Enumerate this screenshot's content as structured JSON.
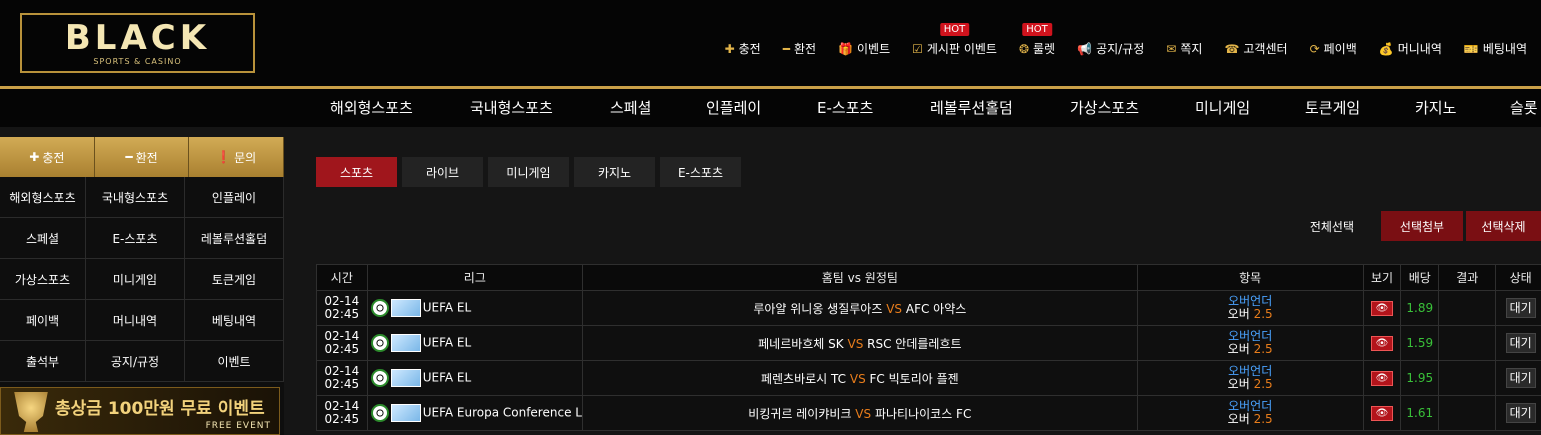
{
  "brand": {
    "logo_main": "BLACK",
    "logo_sub": "SPORTS & CASINO",
    "accent": "#caa048"
  },
  "top_menu": [
    {
      "icon": "plus-icon",
      "glyph": "✚",
      "label": "충전",
      "hot": ""
    },
    {
      "icon": "minus-icon",
      "glyph": "━",
      "label": "환전",
      "hot": ""
    },
    {
      "icon": "gift-icon",
      "glyph": "🎁",
      "label": "이벤트",
      "hot": ""
    },
    {
      "icon": "checkbox-icon",
      "glyph": "☑",
      "label": "게시판 이벤트",
      "hot": "HOT"
    },
    {
      "icon": "roulette-icon",
      "glyph": "❂",
      "label": "룰렛",
      "hot": "HOT"
    },
    {
      "icon": "megaphone-icon",
      "glyph": "📢",
      "label": "공지/규정",
      "hot": ""
    },
    {
      "icon": "envelope-icon",
      "glyph": "✉",
      "label": "쪽지",
      "hot": ""
    },
    {
      "icon": "support-icon",
      "glyph": "☎",
      "label": "고객센터",
      "hot": ""
    },
    {
      "icon": "refresh-icon",
      "glyph": "⟳",
      "label": "페이백",
      "hot": ""
    },
    {
      "icon": "moneybag-icon",
      "glyph": "💰",
      "label": "머니내역",
      "hot": ""
    },
    {
      "icon": "ticket-icon",
      "glyph": "🎫",
      "label": "베팅내역",
      "hot": ""
    }
  ],
  "main_nav": [
    "해외형스포츠",
    "국내형스포츠",
    "스페셜",
    "인플레이",
    "E-스포츠",
    "레볼루션홀덤",
    "가상스포츠",
    "미니게임",
    "토큰게임",
    "카지노",
    "슬롯"
  ],
  "sidebar": {
    "top": [
      {
        "icon": "plus-icon",
        "glyph": "✚",
        "label": "충전"
      },
      {
        "icon": "minus-icon",
        "glyph": "━",
        "label": "환전"
      },
      {
        "icon": "info-icon",
        "glyph": "❗",
        "label": "문의"
      }
    ],
    "grid": [
      "해외형스포츠",
      "국내형스포츠",
      "인플레이",
      "스페셜",
      "E-스포츠",
      "레볼루션홀덤",
      "가상스포츠",
      "미니게임",
      "토큰게임",
      "페이백",
      "머니내역",
      "베팅내역",
      "출석부",
      "공지/규정",
      "이벤트"
    ],
    "banner_title": "총상금 100만원 무료 이벤트",
    "banner_sub": "FREE EVENT"
  },
  "tabs": [
    "스포츠",
    "라이브",
    "미니게임",
    "카지노",
    "E-스포츠"
  ],
  "actions": {
    "select_all": "전체선택",
    "attach": "선택첨부",
    "delete": "선택삭제"
  },
  "table": {
    "headers": [
      "시간",
      "리그",
      "홈팀 vs 원정팀",
      "항목",
      "보기",
      "배당",
      "결과",
      "상태"
    ],
    "rows": [
      {
        "date": "02-14",
        "time": "02:45",
        "league": "UEFA EL",
        "home": "루아얄 위니옹 생질루아즈",
        "vs": "VS",
        "away": "AFC 아약스",
        "market": "오버언더",
        "pick": "오버",
        "line": "2.5",
        "odds": "1.89",
        "result": "",
        "status": "대기"
      },
      {
        "date": "02-14",
        "time": "02:45",
        "league": "UEFA EL",
        "home": "페네르바흐체 SK",
        "vs": "VS",
        "away": "RSC 안데를레흐트",
        "market": "오버언더",
        "pick": "오버",
        "line": "2.5",
        "odds": "1.59",
        "result": "",
        "status": "대기"
      },
      {
        "date": "02-14",
        "time": "02:45",
        "league": "UEFA EL",
        "home": "페렌츠바로시 TC",
        "vs": "VS",
        "away": "FC 빅토리아 플젠",
        "market": "오버언더",
        "pick": "오버",
        "line": "2.5",
        "odds": "1.95",
        "result": "",
        "status": "대기"
      },
      {
        "date": "02-14",
        "time": "02:45",
        "league": "UEFA Europa Conference L",
        "home": "비킹귀르 레이캬비크",
        "vs": "VS",
        "away": "파나티나이코스 FC",
        "market": "오버언더",
        "pick": "오버",
        "line": "2.5",
        "odds": "1.61",
        "result": "",
        "status": "대기"
      }
    ]
  }
}
